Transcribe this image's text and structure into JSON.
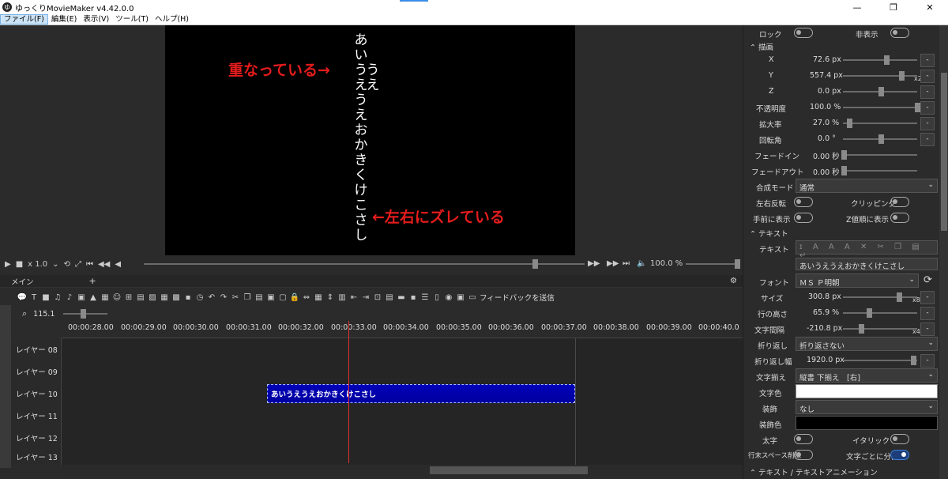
{
  "window": {
    "title": "ゆっくりMovieMaker v4.42.0.0",
    "logo_char": "ゆ",
    "min": "—",
    "max": "❐",
    "close": "✕"
  },
  "menu": [
    "ファイル(F)",
    "編集(E)",
    "表示(V)",
    "ツール(T)",
    "ヘルプ(H)"
  ],
  "preview": {
    "col1": [
      "あ",
      "い",
      "う",
      "え",
      "う",
      "え",
      "お",
      "か",
      "き",
      "く",
      "け",
      "こ",
      "さ",
      "し"
    ],
    "col2": [
      "う",
      "え"
    ],
    "annotation_top": "重なっている→",
    "annotation_bottom": "←左右にズレている"
  },
  "playback": {
    "speed": "x 1.0",
    "volume": "100.0 %"
  },
  "tabs": {
    "main": "メイン",
    "add": "+"
  },
  "toolbar": {
    "feedback": "フィードバックを送信"
  },
  "zoom": {
    "value": "115.1"
  },
  "timeline": {
    "ticks": [
      "00:00:28.00",
      "00:00:29.00",
      "00:00:30.00",
      "00:00:31.00",
      "00:00:32.00",
      "00:00:33.00",
      "00:00:34.00",
      "00:00:35.00",
      "00:00:36.00",
      "00:00:37.00",
      "00:00:38.00",
      "00:00:39.00",
      "00:00:40.0"
    ],
    "layers": [
      "レイヤー 08",
      "レイヤー 09",
      "レイヤー 10",
      "レイヤー 11",
      "レイヤー 12",
      "レイヤー 13"
    ],
    "clip_text": "あいうえうえおかきくけこさし"
  },
  "props": {
    "lock": "ロック",
    "hide": "非表示",
    "draw_section": "描画",
    "x_label": "X",
    "x_val": "72.6 px",
    "y_label": "Y",
    "y_val": "557.4 px",
    "y_mult": "x2",
    "z_label": "Z",
    "z_val": "0.0 px",
    "opacity_label": "不透明度",
    "opacity_val": "100.0 %",
    "scale_label": "拡大率",
    "scale_val": "27.0 %",
    "rot_label": "回転角",
    "rot_val": "0.0 °",
    "fadein_label": "フェードイン",
    "fadein_val": "0.00 秒",
    "fadeout_label": "フェードアウト",
    "fadeout_val": "0.00 秒",
    "blend_label": "合成モード",
    "blend_val": "通常",
    "flip_label": "左右反転",
    "clip_label": "クリッピング",
    "front_label": "手前に表示",
    "zorder_label": "Z値順に表示",
    "text_section": "テキスト",
    "text_label": "テキスト",
    "text_val": "あいうえうえおかきくけこさし",
    "font_label": "フォント",
    "font_val": "ＭＳ Ｐ明朝",
    "size_label": "サイズ",
    "size_val": "300.8 px",
    "size_mult": "x8",
    "lineh_label": "行の高さ",
    "lineh_val": "65.9 %",
    "spacing_label": "文字間隔",
    "spacing_val": "-210.8 px",
    "spacing_mult": "x4",
    "wrap_label": "折り返し",
    "wrap_val": "折り返さない",
    "wrapw_label": "折り返し幅",
    "wrapw_val": "1920.0 px",
    "align_label": "文字揃え",
    "align_val": "縦書 下揃え　[右]",
    "color_label": "文字色",
    "deco_label": "装飾",
    "deco_val": "なし",
    "decocolor_label": "装飾色",
    "bold_label": "太字",
    "italic_label": "イタリック",
    "trim_label": "行末スペース削除",
    "split_label": "文字ごとに分割",
    "anim_section": "テキスト / テキストアニメーション",
    "minus": "-"
  },
  "colors": {
    "accent": "#3b80d8",
    "clip": "#0000b0",
    "playhead": "#e53030",
    "annotation": "#e51c1c"
  }
}
